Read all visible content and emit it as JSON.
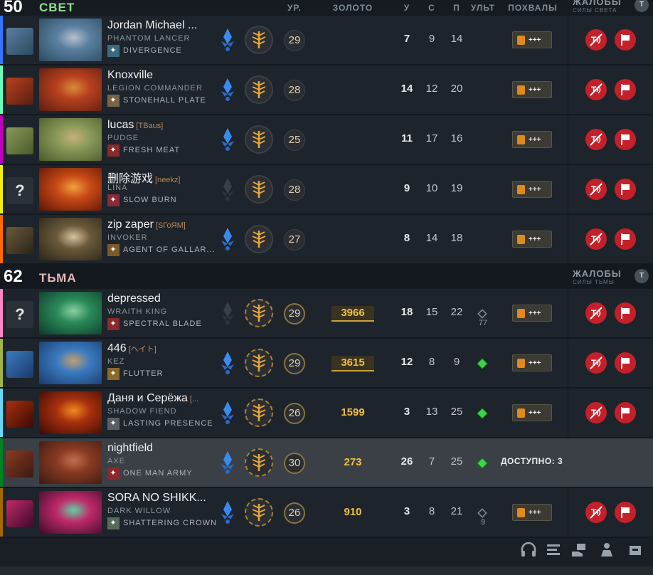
{
  "radiant": {
    "score": "50",
    "name": "СВЕТ",
    "color": "#8fe089",
    "reports_title": "ЖАЛОБЫ",
    "reports_sub": "СИЛЫ СВЕТА"
  },
  "dire": {
    "score": "62",
    "name": "ТЬМА",
    "color": "#e5b8b2",
    "reports_title": "ЖАЛОБЫ",
    "reports_sub": "СИЛЫ ТЬМЫ"
  },
  "columns": {
    "level": "УР.",
    "gold": "ЗОЛОТО",
    "kills": "У",
    "deaths": "С",
    "assists": "П",
    "ult": "УЛЬТ",
    "commends": "ПОХВАЛЫ"
  },
  "players": [
    {
      "name": "Jordan Michael ...",
      "tag": "",
      "hero": "PHANTOM LANCER",
      "item": "DIVERGENCE",
      "level": "29",
      "gold": "",
      "k": "7",
      "d": "9",
      "a": "14",
      "ult": "",
      "ult_count": "",
      "commend": "+++",
      "color": "#3375ff",
      "item_color": "#3a6a80",
      "portrait": [
        "#2b4a5e",
        "#5a7fa0",
        "#b8c0cc"
      ]
    },
    {
      "name": "Knoxville",
      "tag": "",
      "hero": "LEGION COMMANDER",
      "item": "STONEHALL PLATE",
      "level": "28",
      "gold": "",
      "k": "14",
      "d": "12",
      "a": "20",
      "ult": "",
      "ult_count": "",
      "commend": "+++",
      "color": "#66ffbf",
      "item_color": "#7a6446",
      "portrait": [
        "#5a1e12",
        "#b8401e",
        "#d88a3a"
      ]
    },
    {
      "name": "lucas",
      "tag": "[TBaus]",
      "hero": "PUDGE",
      "item": "FRESH MEAT",
      "level": "25",
      "gold": "",
      "k": "11",
      "d": "17",
      "a": "16",
      "ult": "",
      "ult_count": "",
      "commend": "+++",
      "color": "#bf00bf",
      "item_color": "#8a2a2a",
      "portrait": [
        "#4a5a2a",
        "#8a9a5a",
        "#c8b07a"
      ]
    },
    {
      "name": "删除游戏",
      "tag": "[neekz]",
      "hero": "LINA",
      "item": "SLOW BURN",
      "level": "28",
      "gold": "",
      "k": "9",
      "d": "10",
      "a": "19",
      "ult": "",
      "ult_count": "",
      "commend": "+++",
      "color": "#f3f00b",
      "item_color": "#8a2a3a",
      "portrait": [
        "#5a1408",
        "#c84a14",
        "#f0a040"
      ]
    },
    {
      "name": "zip zaper",
      "tag": "[SГоЯM]",
      "hero": "INVOKER",
      "item": "AGENT OF GALLAR...",
      "level": "27",
      "gold": "",
      "k": "8",
      "d": "14",
      "a": "18",
      "ult": "",
      "ult_count": "",
      "commend": "+++",
      "color": "#ff6b00",
      "item_color": "#7a5a2a",
      "portrait": [
        "#2a2418",
        "#6a5a3a",
        "#d8c0a0"
      ]
    },
    {
      "name": "depressed",
      "tag": "",
      "hero": "WRAITH KING",
      "item": "SPECTRAL BLADE",
      "level": "29",
      "gold": "3966",
      "k": "18",
      "d": "15",
      "a": "22",
      "ult": "locked",
      "ult_count": "77",
      "commend": "+++",
      "color": "#fe86c2",
      "item_color": "#8a2a2a",
      "portrait": [
        "#0e3a2a",
        "#2a8a5a",
        "#8ad0a0"
      ]
    },
    {
      "name": "446",
      "tag": "[ヘイト]",
      "hero": "KEZ",
      "item": "FLUTTER",
      "level": "29",
      "gold": "3615",
      "k": "12",
      "d": "8",
      "a": "9",
      "ult": "ready",
      "ult_count": "",
      "commend": "+++",
      "color": "#a1b447",
      "item_color": "#8a6a2a",
      "portrait": [
        "#1a3a6a",
        "#3a7ac0",
        "#c0a070"
      ]
    },
    {
      "name": "Даня и Серёжа",
      "tag": "[...",
      "hero": "SHADOW FIEND",
      "item": "LASTING PRESENCE",
      "level": "26",
      "gold": "1599",
      "k": "3",
      "d": "13",
      "a": "25",
      "ult": "ready",
      "ult_count": "",
      "commend": "+++",
      "color": "#65d9f7",
      "item_color": "#5a5f66",
      "portrait": [
        "#3a0a04",
        "#a8300e",
        "#f08a20"
      ]
    },
    {
      "name": "nightfield",
      "tag": "",
      "hero": "AXE",
      "item": "ONE MAN ARMY",
      "level": "30",
      "gold": "273",
      "k": "26",
      "d": "7",
      "a": "25",
      "ult": "ready",
      "ult_count": "",
      "commend": "",
      "available": "ДОСТУПНО: 3",
      "color": "#008321",
      "item_color": "#8a2a2a",
      "portrait": [
        "#3a1a12",
        "#8a3a22",
        "#c07050"
      ]
    },
    {
      "name": "SORA NO SHIKK...",
      "tag": "",
      "hero": "DARK WILLOW",
      "item": "SHATTERING CROWN",
      "level": "26",
      "gold": "910",
      "k": "3",
      "d": "8",
      "a": "21",
      "ult": "locked",
      "ult_count": "9",
      "commend": "+++",
      "color": "#a46900",
      "item_color": "#5a6a5a",
      "portrait": [
        "#3a0a2a",
        "#c02a6a",
        "#60d0a0"
      ]
    }
  ]
}
